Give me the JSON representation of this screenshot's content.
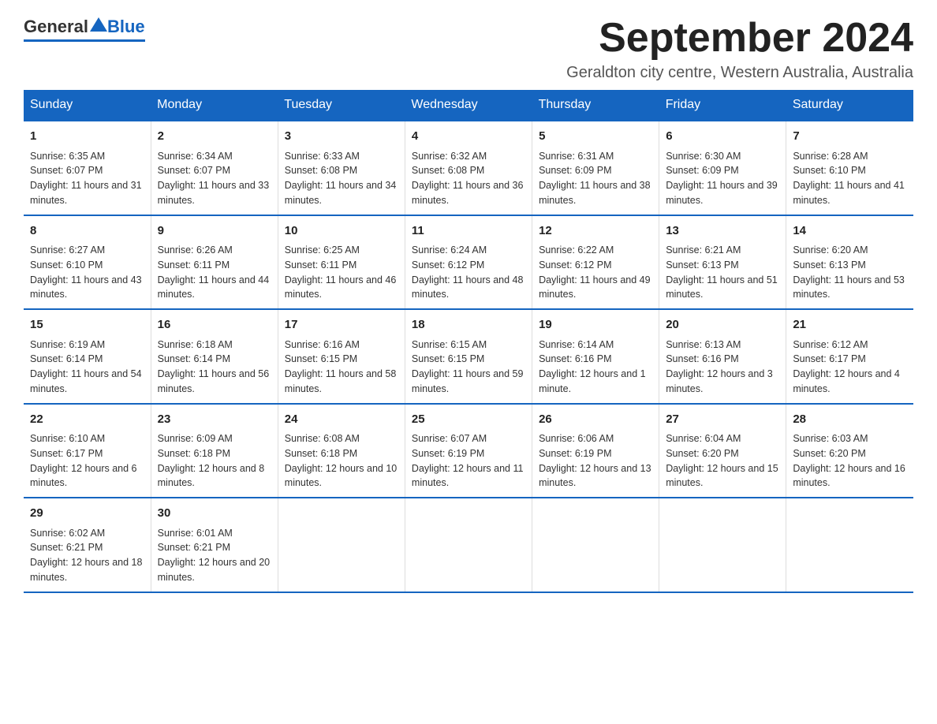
{
  "header": {
    "logo_general": "General",
    "logo_blue": "Blue",
    "month_title": "September 2024",
    "location": "Geraldton city centre, Western Australia, Australia"
  },
  "weekdays": [
    "Sunday",
    "Monday",
    "Tuesday",
    "Wednesday",
    "Thursday",
    "Friday",
    "Saturday"
  ],
  "weeks": [
    [
      {
        "day": "1",
        "sunrise": "6:35 AM",
        "sunset": "6:07 PM",
        "daylight": "11 hours and 31 minutes."
      },
      {
        "day": "2",
        "sunrise": "6:34 AM",
        "sunset": "6:07 PM",
        "daylight": "11 hours and 33 minutes."
      },
      {
        "day": "3",
        "sunrise": "6:33 AM",
        "sunset": "6:08 PM",
        "daylight": "11 hours and 34 minutes."
      },
      {
        "day": "4",
        "sunrise": "6:32 AM",
        "sunset": "6:08 PM",
        "daylight": "11 hours and 36 minutes."
      },
      {
        "day": "5",
        "sunrise": "6:31 AM",
        "sunset": "6:09 PM",
        "daylight": "11 hours and 38 minutes."
      },
      {
        "day": "6",
        "sunrise": "6:30 AM",
        "sunset": "6:09 PM",
        "daylight": "11 hours and 39 minutes."
      },
      {
        "day": "7",
        "sunrise": "6:28 AM",
        "sunset": "6:10 PM",
        "daylight": "11 hours and 41 minutes."
      }
    ],
    [
      {
        "day": "8",
        "sunrise": "6:27 AM",
        "sunset": "6:10 PM",
        "daylight": "11 hours and 43 minutes."
      },
      {
        "day": "9",
        "sunrise": "6:26 AM",
        "sunset": "6:11 PM",
        "daylight": "11 hours and 44 minutes."
      },
      {
        "day": "10",
        "sunrise": "6:25 AM",
        "sunset": "6:11 PM",
        "daylight": "11 hours and 46 minutes."
      },
      {
        "day": "11",
        "sunrise": "6:24 AM",
        "sunset": "6:12 PM",
        "daylight": "11 hours and 48 minutes."
      },
      {
        "day": "12",
        "sunrise": "6:22 AM",
        "sunset": "6:12 PM",
        "daylight": "11 hours and 49 minutes."
      },
      {
        "day": "13",
        "sunrise": "6:21 AM",
        "sunset": "6:13 PM",
        "daylight": "11 hours and 51 minutes."
      },
      {
        "day": "14",
        "sunrise": "6:20 AM",
        "sunset": "6:13 PM",
        "daylight": "11 hours and 53 minutes."
      }
    ],
    [
      {
        "day": "15",
        "sunrise": "6:19 AM",
        "sunset": "6:14 PM",
        "daylight": "11 hours and 54 minutes."
      },
      {
        "day": "16",
        "sunrise": "6:18 AM",
        "sunset": "6:14 PM",
        "daylight": "11 hours and 56 minutes."
      },
      {
        "day": "17",
        "sunrise": "6:16 AM",
        "sunset": "6:15 PM",
        "daylight": "11 hours and 58 minutes."
      },
      {
        "day": "18",
        "sunrise": "6:15 AM",
        "sunset": "6:15 PM",
        "daylight": "11 hours and 59 minutes."
      },
      {
        "day": "19",
        "sunrise": "6:14 AM",
        "sunset": "6:16 PM",
        "daylight": "12 hours and 1 minute."
      },
      {
        "day": "20",
        "sunrise": "6:13 AM",
        "sunset": "6:16 PM",
        "daylight": "12 hours and 3 minutes."
      },
      {
        "day": "21",
        "sunrise": "6:12 AM",
        "sunset": "6:17 PM",
        "daylight": "12 hours and 4 minutes."
      }
    ],
    [
      {
        "day": "22",
        "sunrise": "6:10 AM",
        "sunset": "6:17 PM",
        "daylight": "12 hours and 6 minutes."
      },
      {
        "day": "23",
        "sunrise": "6:09 AM",
        "sunset": "6:18 PM",
        "daylight": "12 hours and 8 minutes."
      },
      {
        "day": "24",
        "sunrise": "6:08 AM",
        "sunset": "6:18 PM",
        "daylight": "12 hours and 10 minutes."
      },
      {
        "day": "25",
        "sunrise": "6:07 AM",
        "sunset": "6:19 PM",
        "daylight": "12 hours and 11 minutes."
      },
      {
        "day": "26",
        "sunrise": "6:06 AM",
        "sunset": "6:19 PM",
        "daylight": "12 hours and 13 minutes."
      },
      {
        "day": "27",
        "sunrise": "6:04 AM",
        "sunset": "6:20 PM",
        "daylight": "12 hours and 15 minutes."
      },
      {
        "day": "28",
        "sunrise": "6:03 AM",
        "sunset": "6:20 PM",
        "daylight": "12 hours and 16 minutes."
      }
    ],
    [
      {
        "day": "29",
        "sunrise": "6:02 AM",
        "sunset": "6:21 PM",
        "daylight": "12 hours and 18 minutes."
      },
      {
        "day": "30",
        "sunrise": "6:01 AM",
        "sunset": "6:21 PM",
        "daylight": "12 hours and 20 minutes."
      },
      null,
      null,
      null,
      null,
      null
    ]
  ]
}
